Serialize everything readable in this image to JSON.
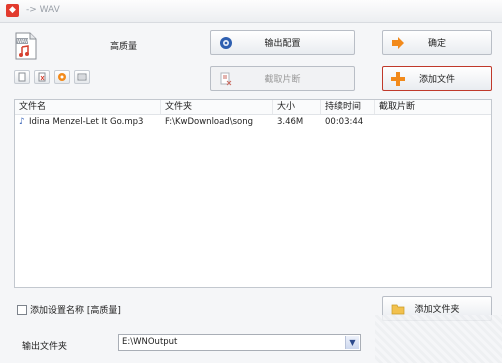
{
  "window": {
    "title": "-> WAV"
  },
  "format": {
    "icon_caption": "WAV",
    "quality": "高质量"
  },
  "toolbar": {
    "output_config": "输出配置",
    "confirm": "确定",
    "cut_clip": "截取片断",
    "add_file": "添加文件",
    "add_folder": "添加文件夹"
  },
  "table": {
    "columns": [
      "文件名",
      "文件夹",
      "大小",
      "持续时间",
      "截取片断"
    ],
    "rows": [
      {
        "name": "Idina Menzel-Let It Go.mp3",
        "folder": "F:\\KwDownload\\song",
        "size": "3.46M",
        "duration": "00:03:44",
        "clip": ""
      }
    ]
  },
  "settings": {
    "add_setting_name_label": "添加设置名称 [高质量]",
    "output_folder_label": "输出文件夹",
    "output_folder_value": "E:\\WNOutput"
  },
  "colors": {
    "accent": "#e23b2e",
    "add_icon": "#f28a1b"
  }
}
